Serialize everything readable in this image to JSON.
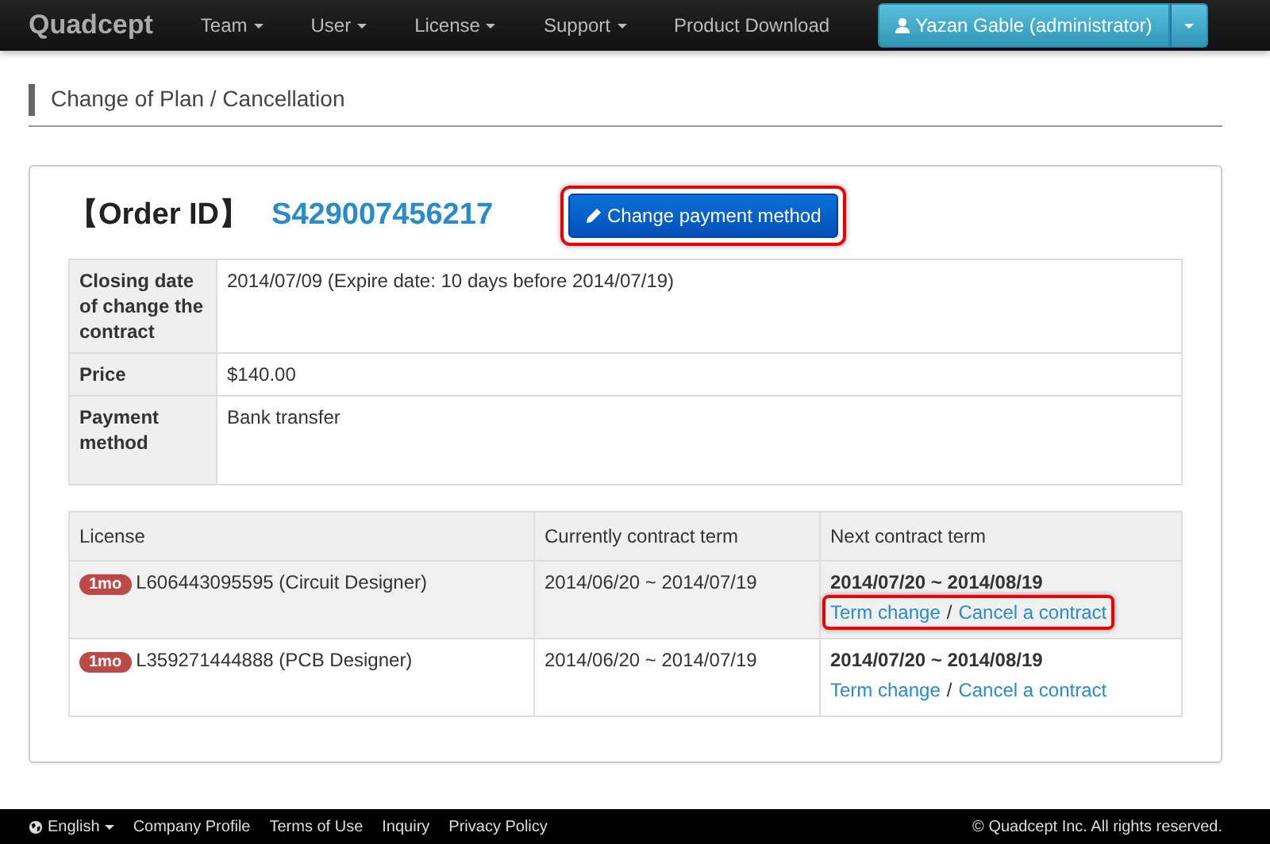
{
  "navbar": {
    "brand": "Quadcept",
    "menus": [
      {
        "label": "Team",
        "dropdown": true
      },
      {
        "label": "User",
        "dropdown": true
      },
      {
        "label": "License",
        "dropdown": true
      },
      {
        "label": "Support",
        "dropdown": true
      },
      {
        "label": "Product Download",
        "dropdown": false
      }
    ],
    "user_button": "Yazan Gable (administrator)"
  },
  "page_title": "Change of Plan / Cancellation",
  "order": {
    "label": "【Order ID】",
    "id": "S429007456217",
    "button": {
      "label": "Change payment method",
      "highlighted": true
    }
  },
  "details": [
    {
      "label": "Closing date of change the contract",
      "value": "2014/07/09 (Expire date: 10 days before 2014/07/19)"
    },
    {
      "label": "Price",
      "value": "$140.00"
    },
    {
      "label": "Payment method",
      "value": "Bank transfer"
    }
  ],
  "licenses": {
    "columns": [
      "License",
      "Currently contract term",
      "Next contract term"
    ],
    "rows": [
      {
        "badge": "1mo",
        "license": "L606443095595 (Circuit Designer)",
        "current_term": "2014/06/20 ~ 2014/07/19",
        "next_term": "2014/07/20 ~ 2014/08/19",
        "links": [
          "Term change",
          "Cancel a contract"
        ],
        "separator": "/",
        "shaded": true,
        "highlighted": true
      },
      {
        "badge": "1mo",
        "license": "L359271444888 (PCB Designer)",
        "current_term": "2014/06/20 ~ 2014/07/19",
        "next_term": "2014/07/20 ~ 2014/08/19",
        "links": [
          "Term change",
          "Cancel a contract"
        ],
        "separator": "/",
        "shaded": false,
        "highlighted": false
      }
    ]
  },
  "footer": {
    "language": "English",
    "links": [
      "Company Profile",
      "Terms of Use",
      "Inquiry",
      "Privacy Policy"
    ],
    "copyright": "© Quadcept Inc. All rights reserved."
  }
}
